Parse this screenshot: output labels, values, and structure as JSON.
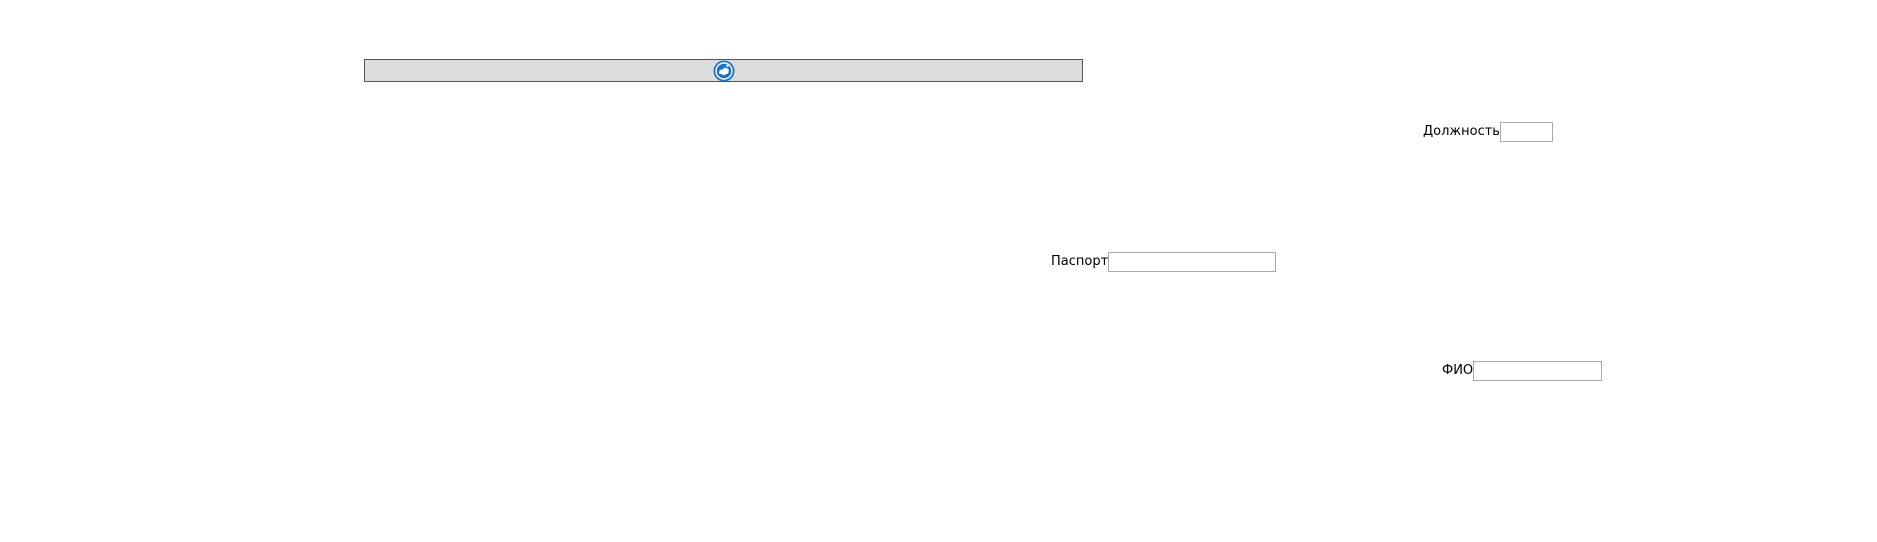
{
  "toolbar": {
    "icon": "globe-refresh-icon",
    "icon_color": "#1a73c8"
  },
  "form": {
    "position": {
      "label": "Должность",
      "value": "",
      "placeholder": ""
    },
    "passport": {
      "label": "Паспорт",
      "value": "",
      "placeholder": ""
    },
    "fio": {
      "label": "ФИО",
      "value": "",
      "placeholder": ""
    }
  },
  "colors": {
    "bar_background": "#dcdcdc",
    "bar_border": "#555555",
    "input_border": "#a9a9a9"
  }
}
